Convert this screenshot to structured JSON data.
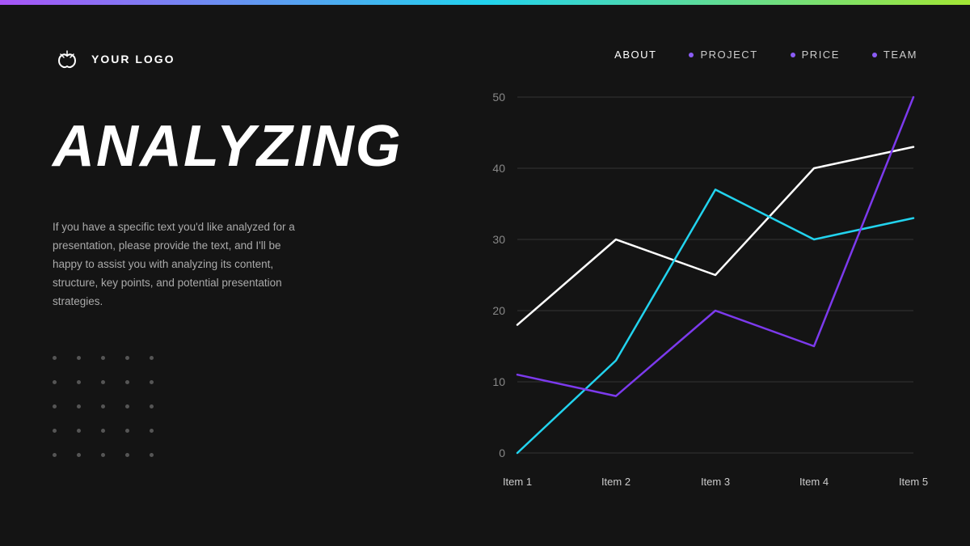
{
  "topbar": {
    "gradient": "linear-gradient(to right, #a855f7, #22d3ee, #a3e635)"
  },
  "logo": {
    "text": "YOUR LOGO"
  },
  "nav": {
    "items": [
      {
        "label": "ABOUT",
        "dot": false
      },
      {
        "label": "PROJECT",
        "dot": true
      },
      {
        "label": "PRICE",
        "dot": true
      },
      {
        "label": "TEAM",
        "dot": true
      }
    ]
  },
  "main": {
    "title": "ANALYZING",
    "body_text": "If you have a specific text you'd like analyzed for a presentation, please provide the text, and I'll be happy to assist you with analyzing its content, structure, key points, and potential presentation strategies."
  },
  "chart": {
    "y_labels": [
      "0",
      "10",
      "20",
      "30",
      "40",
      "50"
    ],
    "x_labels": [
      "Item 1",
      "Item 2",
      "Item 3",
      "Item 4",
      "Item 5"
    ],
    "lines": {
      "white": [
        18,
        30,
        25,
        40,
        43
      ],
      "cyan": [
        0,
        13,
        37,
        30,
        33
      ],
      "purple": [
        11,
        8,
        20,
        15,
        50
      ]
    },
    "colors": {
      "white": "#ffffff",
      "cyan": "#22d3ee",
      "purple": "#7c3aed"
    }
  }
}
